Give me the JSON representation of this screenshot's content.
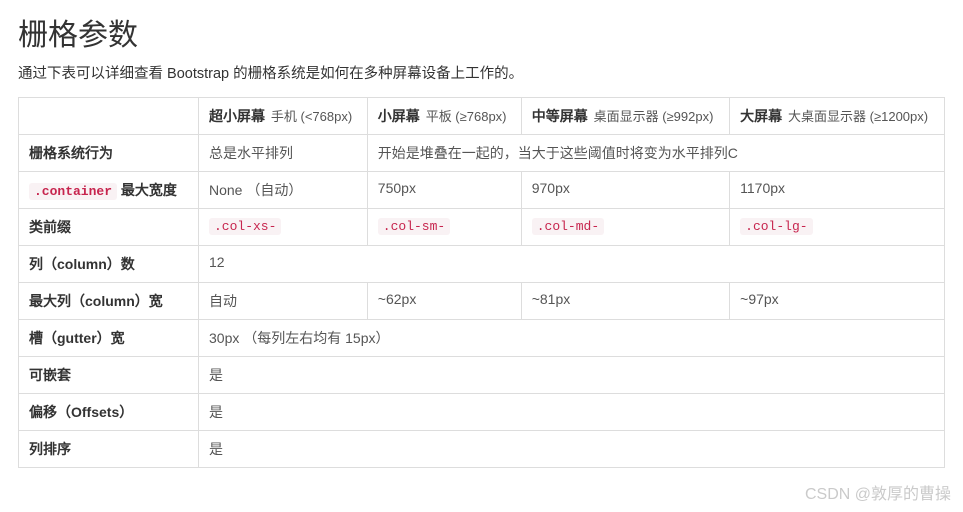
{
  "heading": "栅格参数",
  "lead": "通过下表可以详细查看 Bootstrap 的栅格系统是如何在多种屏幕设备上工作的。",
  "columns": [
    {
      "title": "超小屏幕",
      "sub": "手机 (<768px)"
    },
    {
      "title": "小屏幕",
      "sub": "平板 (≥768px)"
    },
    {
      "title": "中等屏幕",
      "sub": "桌面显示器 (≥992px)"
    },
    {
      "title": "大屏幕",
      "sub": "大桌面显示器 (≥1200px)"
    }
  ],
  "rows": {
    "behavior": {
      "label": "栅格系统行为",
      "c0": "总是水平排列",
      "c_span": "开始是堆叠在一起的，当大于这些阈值时将变为水平排列C"
    },
    "maxwidth": {
      "label_code": ".container",
      "label_text": " 最大宽度",
      "c0": "None （自动）",
      "c1": "750px",
      "c2": "970px",
      "c3": "1170px"
    },
    "prefix": {
      "label": "类前缀",
      "c0": ".col-xs-",
      "c1": ".col-sm-",
      "c2": ".col-md-",
      "c3": ".col-lg-"
    },
    "cols": {
      "label": "列（column）数",
      "c_all": "12"
    },
    "colwidth": {
      "label": "最大列（column）宽",
      "c0": "自动",
      "c1": "~62px",
      "c2": "~81px",
      "c3": "~97px"
    },
    "gutter": {
      "label": "槽（gutter）宽",
      "c_all": "30px （每列左右均有 15px）"
    },
    "nestable": {
      "label": "可嵌套",
      "c_all": "是"
    },
    "offsets": {
      "label": "偏移（Offsets）",
      "c_all": "是"
    },
    "ordering": {
      "label": "列排序",
      "c_all": "是"
    }
  },
  "watermark": "CSDN @敦厚的曹操"
}
